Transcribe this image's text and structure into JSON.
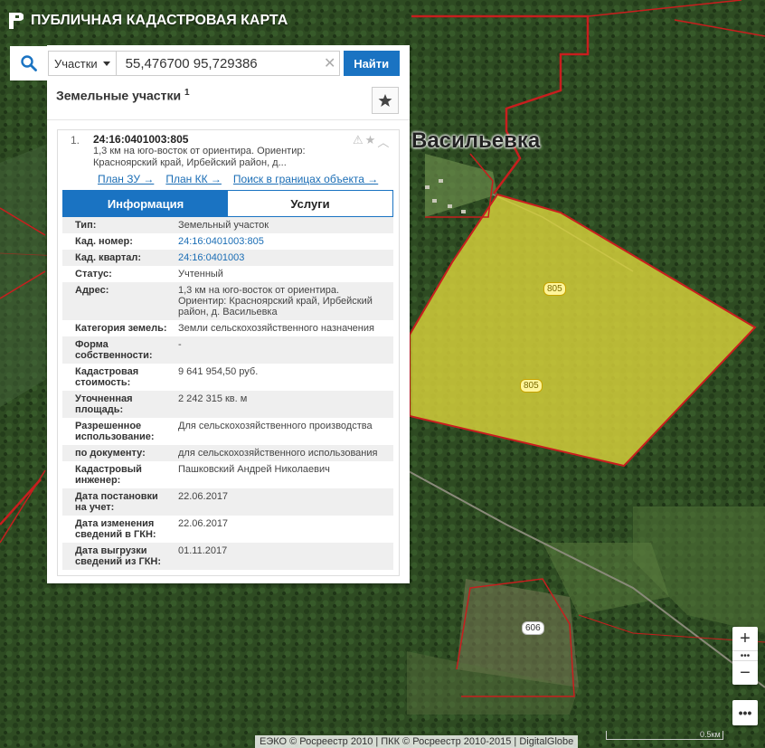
{
  "app": {
    "title": "ПУБЛИЧНАЯ КАДАСТРОВАЯ КАРТА"
  },
  "search": {
    "type_label": "Участки",
    "value": "55,476700 95,729386",
    "find_label": "Найти"
  },
  "results": {
    "heading": "Земельные участки",
    "count": "1",
    "item": {
      "number": "1.",
      "cad_number": "24:16:0401003:805",
      "address_short": "1,3 км на юго-восток от ориентира. Ориентир: Красноярский край, Ирбейский район, д...",
      "links": [
        "План ЗУ →",
        "План КК →",
        "Поиск в границах объекта →"
      ]
    }
  },
  "tabs": {
    "info": "Информация",
    "services": "Услуги"
  },
  "details": [
    {
      "key": "Тип:",
      "value": "Земельный участок",
      "link": false
    },
    {
      "key": "Кад. номер:",
      "value": "24:16:0401003:805",
      "link": true
    },
    {
      "key": "Кад. квартал:",
      "value": "24:16:0401003",
      "link": true
    },
    {
      "key": "Статус:",
      "value": "Учтенный",
      "link": false
    },
    {
      "key": "Адрес:",
      "value": "1,3 км на юго-восток от ориентира. Ориентир: Красноярский край, Ирбейский район, д. Васильевка",
      "link": false
    },
    {
      "key": "Категория земель:",
      "value": "Земли сельскохозяйственного назначения",
      "link": false
    },
    {
      "key": "Форма собственности:",
      "value": "-",
      "link": false
    },
    {
      "key": "Кадастровая стоимость:",
      "value": "9 641 954,50 руб.",
      "link": false
    },
    {
      "key": "Уточненная площадь:",
      "value": "2 242 315 кв. м",
      "link": false
    },
    {
      "key": "Разрешенное использование:",
      "value": "Для сельскохозяйственного производства",
      "link": false
    },
    {
      "key": "по документу:",
      "value": "для сельскохозяйственного использования",
      "link": false
    },
    {
      "key": "Кадастровый инженер:",
      "value": "Пашковский Андрей Николаевич",
      "link": false
    },
    {
      "key": "Дата постановки на учет:",
      "value": "22.06.2017",
      "link": false
    },
    {
      "key": "Дата изменения сведений в ГКН:",
      "value": "22.06.2017",
      "link": false
    },
    {
      "key": "Дата выгрузки сведений из ГКН:",
      "value": "01.11.2017",
      "link": false
    }
  ],
  "map": {
    "village": "Васильевка",
    "parcel_labels": [
      "805",
      "805"
    ],
    "other_parcel_label": "606",
    "attribution": "ЕЭКО © Росреестр 2010 | ПКК © Росреестр 2010-2015 | DigitalGlobe",
    "scale_label": "0.5км",
    "colors": {
      "selected_fill": "#d8d23a",
      "boundary": "#c81e1e",
      "accent": "#1a73c2"
    }
  },
  "controls": {
    "zoom_in": "+",
    "zoom_mid": "•••",
    "zoom_out": "−",
    "more": "•••"
  },
  "icons": [
    "logo-icon",
    "search-icon",
    "chevron-down-icon",
    "clear-icon",
    "star-icon",
    "warning-icon",
    "chevron-up-icon"
  ]
}
